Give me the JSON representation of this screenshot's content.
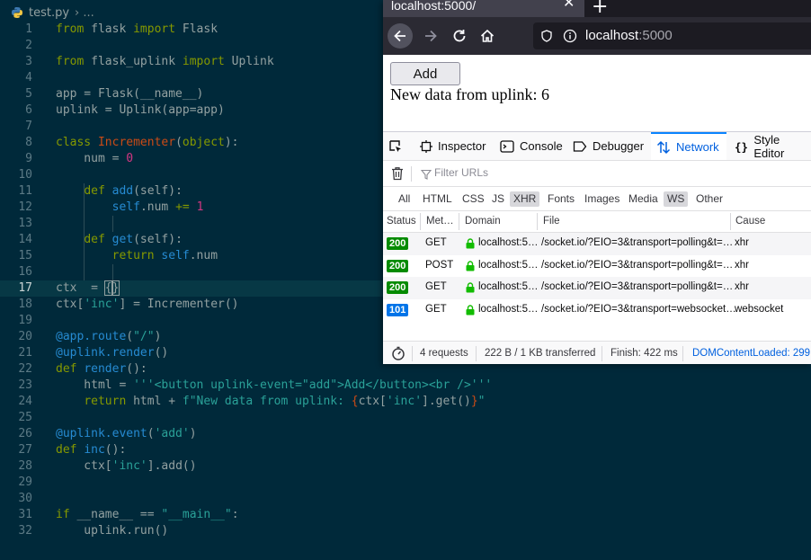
{
  "editor": {
    "tab_name": "test.py",
    "breadcrumb_sep": "› ...",
    "line_numbers": [
      "1",
      "2",
      "3",
      "4",
      "5",
      "6",
      "7",
      "8",
      "9",
      "10",
      "11",
      "12",
      "13",
      "14",
      "15",
      "16",
      "17",
      "18",
      "19",
      "20",
      "21",
      "22",
      "23",
      "24",
      "25",
      "26",
      "27",
      "28",
      "29",
      "30",
      "31",
      "32"
    ]
  },
  "browser": {
    "tab_title": "localhost:5000/",
    "url_host": "localhost",
    "url_port": ":5000",
    "page": {
      "button_label": "Add",
      "text": "New data from uplink: 6"
    },
    "devtools": {
      "tabs": [
        "Inspector",
        "Console",
        "Debugger",
        "Network",
        "Style Editor"
      ],
      "filter_placeholder": "Filter URLs",
      "types": [
        "All",
        "HTML",
        "CSS",
        "JS",
        "XHR",
        "Fonts",
        "Images",
        "Media",
        "WS",
        "Other"
      ],
      "columns": [
        "Status",
        "Met…",
        "Domain",
        "File",
        "Cause"
      ],
      "requests": [
        {
          "status": "200",
          "method": "GET",
          "domain": "localhost:5…",
          "file": "/socket.io/?EIO=3&transport=polling&t=…",
          "cause": "xhr",
          "status_color": "#058b00"
        },
        {
          "status": "200",
          "method": "POST",
          "domain": "localhost:5…",
          "file": "/socket.io/?EIO=3&transport=polling&t=…",
          "cause": "xhr",
          "status_color": "#058b00"
        },
        {
          "status": "200",
          "method": "GET",
          "domain": "localhost:5…",
          "file": "/socket.io/?EIO=3&transport=polling&t=…",
          "cause": "xhr",
          "status_color": "#058b00"
        },
        {
          "status": "101",
          "method": "GET",
          "domain": "localhost:5…",
          "file": "/socket.io/?EIO=3&transport=websocket…",
          "cause": "websocket",
          "status_color": "#0074e8"
        }
      ],
      "summary": {
        "requests": "4 requests",
        "transferred": "222 B / 1 KB transferred",
        "finish": "Finish: 422 ms",
        "dom_loaded": "DOMContentLoaded: 299 ms"
      }
    }
  },
  "colors": {
    "editor_bg": "#00293a",
    "keyword": "#859900",
    "class_name": "#cb4b16",
    "number": "#d33682",
    "string": "#2aa198",
    "accent": "#0a84ff"
  }
}
